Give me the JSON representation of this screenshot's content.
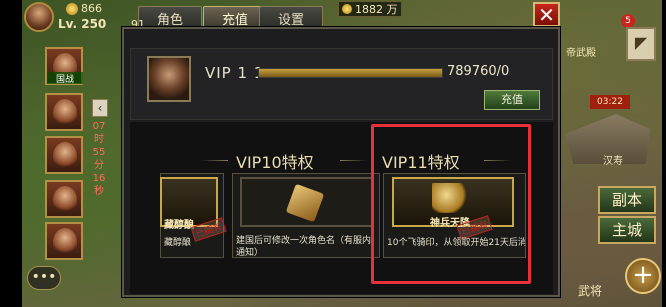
{
  "player": {
    "level": "Lv. 250",
    "gold": "866",
    "res_a": "91",
    "res_b": "1882 万"
  },
  "tabs": [
    {
      "label": "角色",
      "active": false
    },
    {
      "label": "充值",
      "active": true
    },
    {
      "label": "设置",
      "active": false
    }
  ],
  "sidebar": {
    "items": [
      {
        "tag": "国战"
      },
      {
        "tag": ""
      },
      {
        "tag": ""
      },
      {
        "tag": ""
      }
    ],
    "timer": [
      "07",
      "时",
      "55",
      "分",
      "16",
      "秒"
    ]
  },
  "right": {
    "notification_count": "5",
    "label_top": "帝武殿",
    "time": "03:22",
    "city": "汉寿",
    "btn_fuben": "副本",
    "btn_zhucheng": "主城",
    "btn_wujiang": "武将"
  },
  "vip": {
    "title": "VIP 1 1",
    "progress_text": "789760/0",
    "progress_fraction": 1.0,
    "recharge": "充值"
  },
  "privileges": [
    {
      "title": "VIP10特权",
      "card_text": "建国后可修改一次角色名（有服内通知）"
    },
    {
      "title": "VIP11特权",
      "item_name": "神兵天降",
      "stamp": "已拥有",
      "card_text": "10个飞骑印，从领取开始21天后消失"
    }
  ],
  "left_card": {
    "item_name": "藏醇酿",
    "stamp": "已拥有",
    "card_text": "藏醇酿"
  },
  "colors": {
    "highlight": "#e8303a",
    "accent_gold": "#c8a848"
  }
}
